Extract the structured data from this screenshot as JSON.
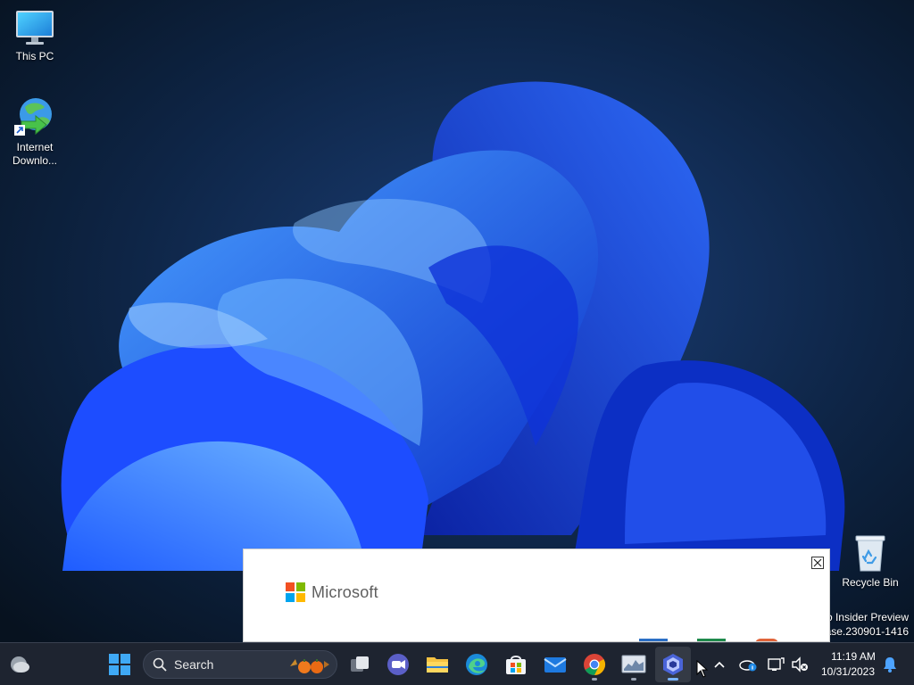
{
  "desktop": {
    "icons": [
      {
        "label": "This PC"
      },
      {
        "label": "Internet Downlo..."
      },
      {
        "label": "Recycle Bin"
      }
    ],
    "watermark": {
      "line1": "o Insider Preview",
      "line2": "ease.230901-1416"
    }
  },
  "popup": {
    "brand": "Microsoft"
  },
  "taskbar": {
    "search_label": "Search",
    "clock": {
      "time": "11:19 AM",
      "date": "10/31/2023"
    }
  },
  "colors": {
    "ms_red": "#f25022",
    "ms_green": "#7fba00",
    "ms_blue": "#00a4ef",
    "ms_yellow": "#ffb900",
    "accent": "#7ab4ff"
  }
}
